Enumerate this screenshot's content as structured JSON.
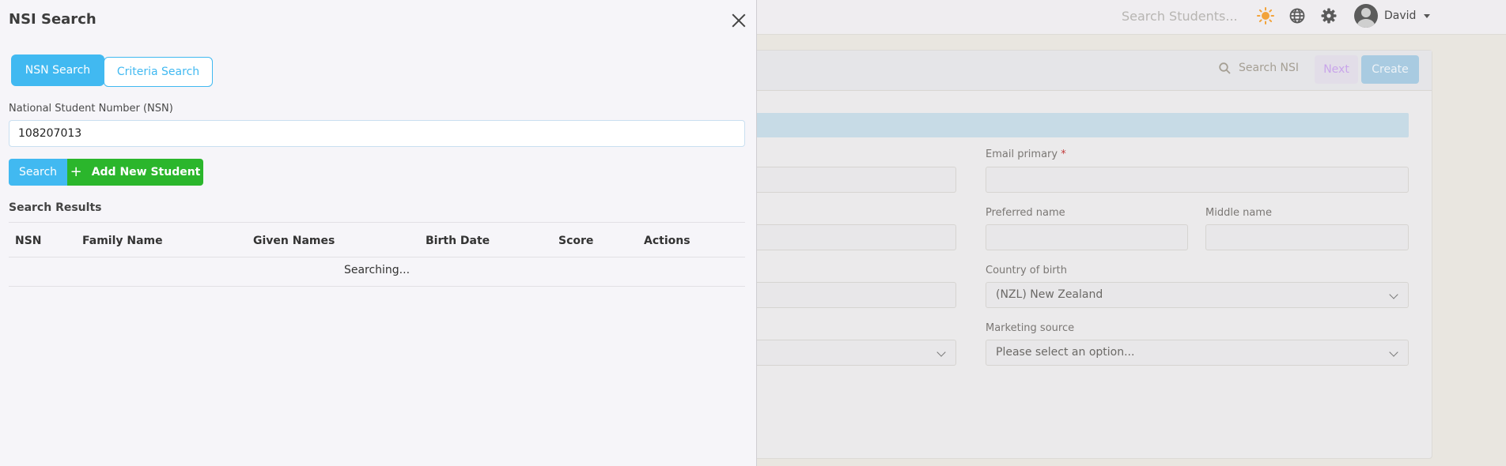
{
  "background": {
    "search_placeholder": "Search Students...",
    "user_name": "David",
    "card_header": {
      "search_nsi_label": "Search NSI",
      "next_label": "Next",
      "create_label": "Create"
    },
    "fields": {
      "email_primary_label": "Email primary",
      "required_mark": "*",
      "preferred_name_label": "Preferred name",
      "middle_name_label": "Middle name",
      "country_of_birth_label": "Country of birth",
      "country_of_birth_value": "(NZL) New Zealand",
      "marketing_source_label": "Marketing source",
      "marketing_source_value": "Please select an option..."
    }
  },
  "panel": {
    "title": "NSI Search",
    "tabs": [
      {
        "label": "NSN Search",
        "active": true
      },
      {
        "label": "Criteria Search",
        "active": false
      }
    ],
    "nsn_label": "National Student Number (NSN)",
    "nsn_value": "108207013",
    "search_button": "Search",
    "add_button": "Add New Student",
    "results_title": "Search Results",
    "table": {
      "columns": [
        "NSN",
        "Family Name",
        "Given Names",
        "Birth Date",
        "Score",
        "Actions"
      ],
      "status": "Searching..."
    }
  },
  "colors": {
    "primary": "#41b9f1",
    "success": "#2bb62c",
    "sun_icon": "#f2a33a"
  },
  "icons": [
    "close-icon",
    "plus-icon",
    "search-icon",
    "sun-icon",
    "globe-icon",
    "gear-icon",
    "chevron-down-icon"
  ]
}
